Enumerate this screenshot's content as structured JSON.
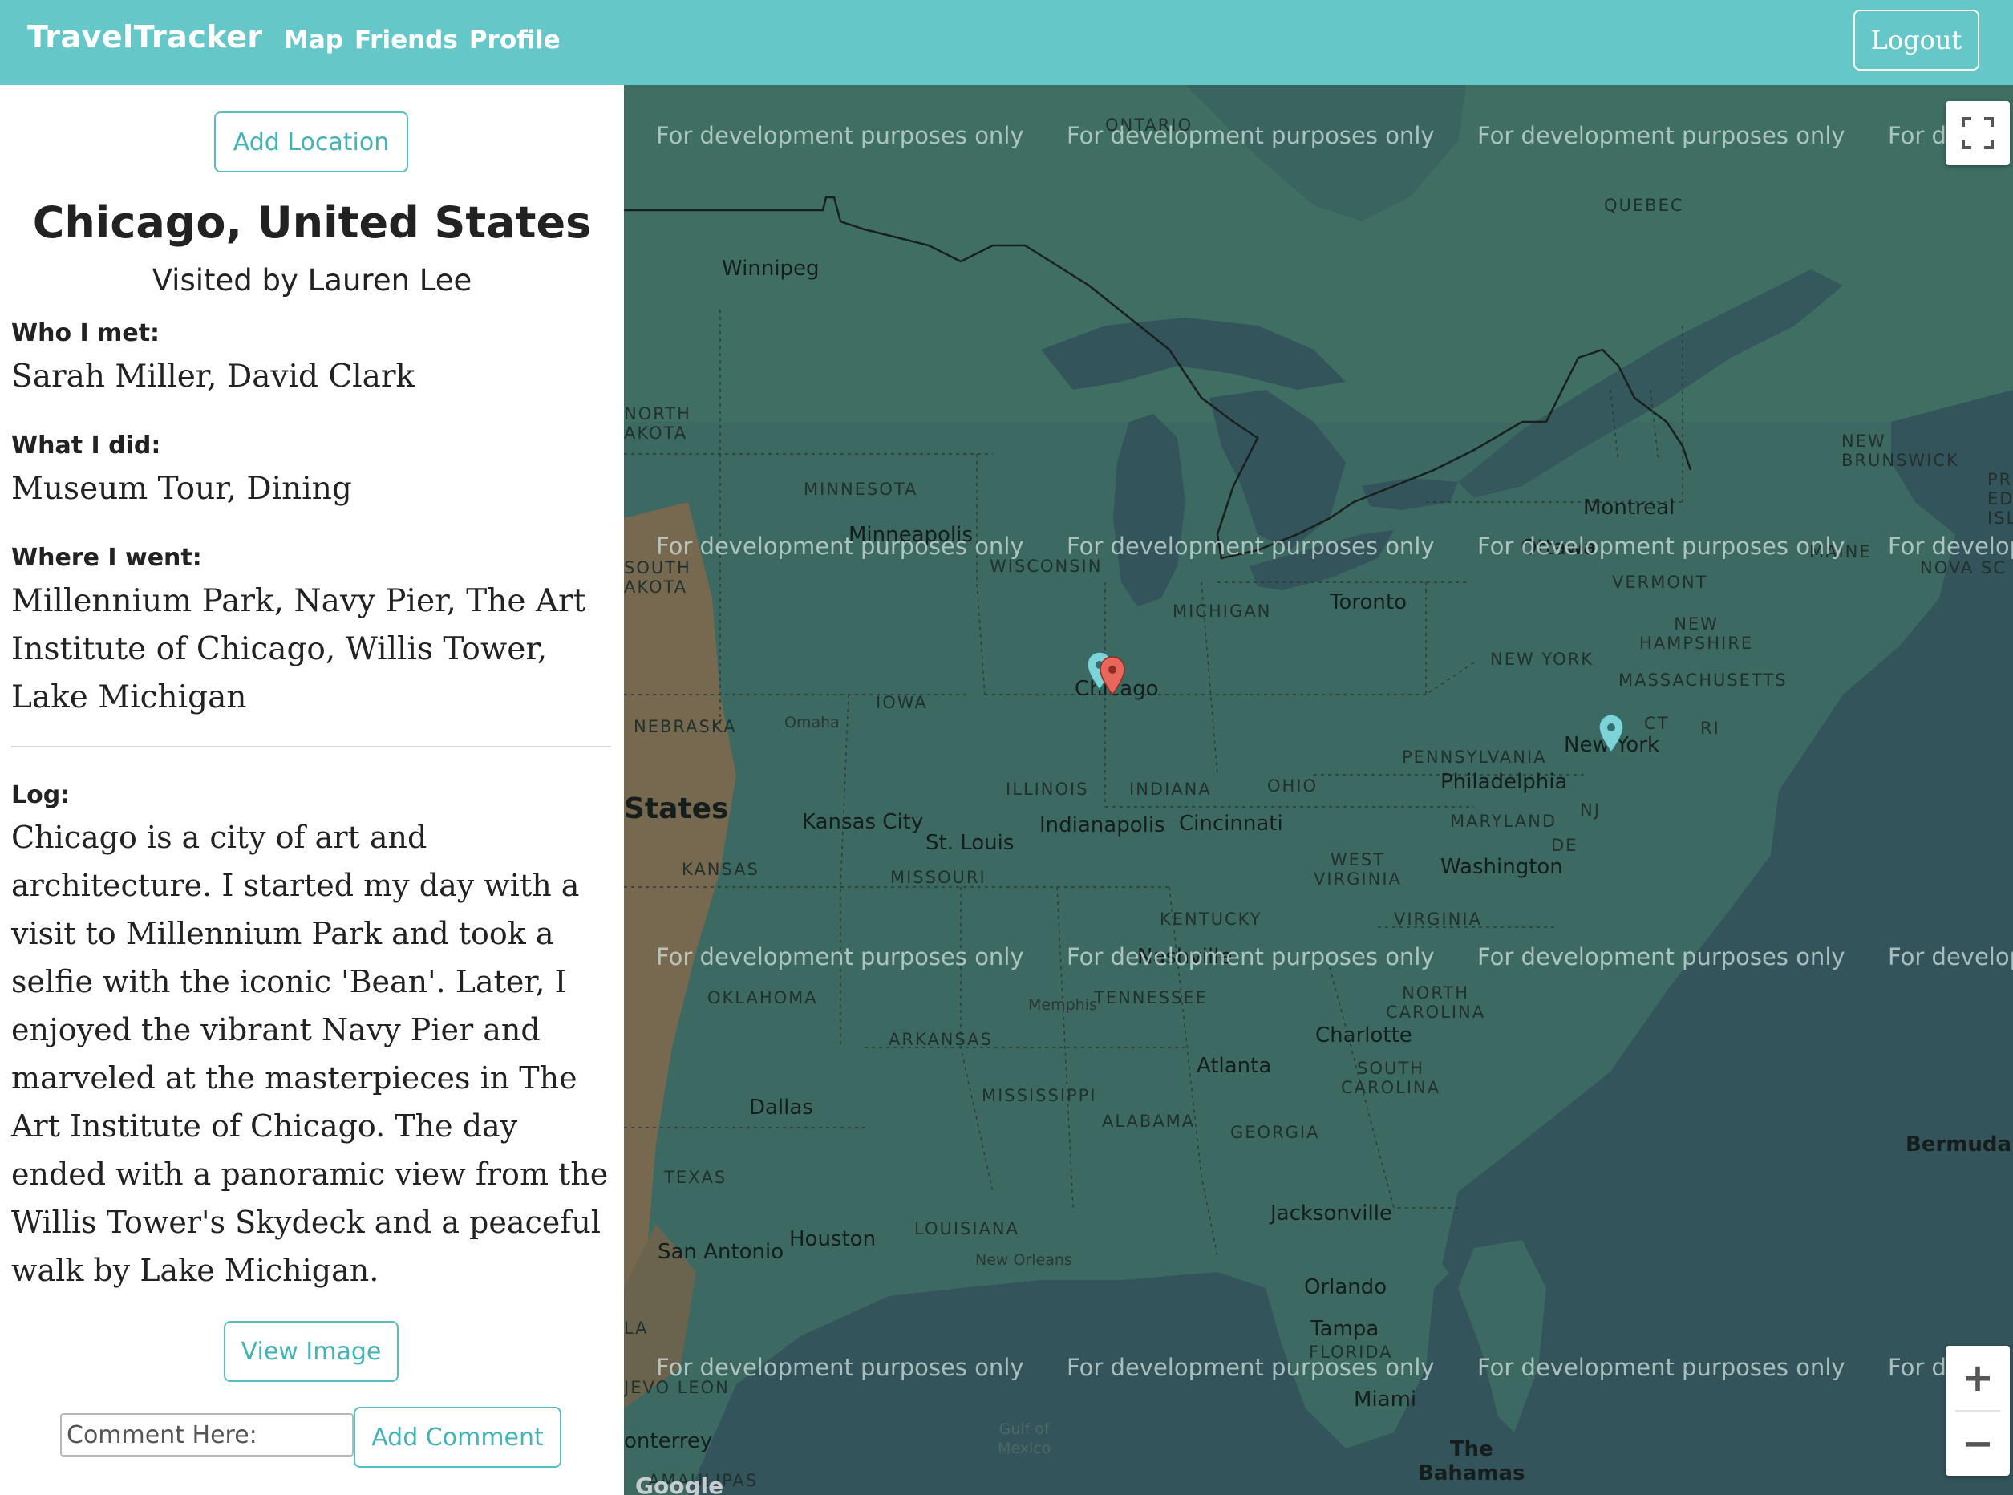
{
  "nav": {
    "brand": "TravelTracker",
    "links": [
      "Map",
      "Friends",
      "Profile"
    ],
    "logout": "Logout"
  },
  "sidebar": {
    "add_location": "Add Location",
    "title": "Chicago, United States",
    "visited_by": "Visited by Lauren Lee",
    "who_label": "Who I met:",
    "who_value": "Sarah Miller, David Clark",
    "what_label": "What I did:",
    "what_value": "Museum Tour, Dining",
    "where_label": "Where I went:",
    "where_value": "Millennium Park, Navy Pier, The Art Institute of Chicago, Willis Tower, Lake Michigan",
    "log_label": "Log:",
    "log_value": "Chicago is a city of art and architecture. I started my day with a visit to Millennium Park and took a selfie with the iconic 'Bean'. Later, I enjoyed the vibrant Navy Pier and marveled at the masterpieces in The Art Institute of Chicago. The day ended with a panoramic view from the Willis Tower's Skydeck and a peaceful walk by Lake Michigan.",
    "view_image": "View Image",
    "comment_placeholder": "Comment Here:",
    "add_comment": "Add Comment"
  },
  "map": {
    "watermark": "For development purposes only",
    "watermark_clipped": "For d",
    "watermark_clipped2": "For develop",
    "zoom_in": "+",
    "zoom_out": "−",
    "google": "Google",
    "labels": {
      "ontario": "ONTARIO",
      "quebec": "QUEBEC",
      "winnipeg": "Winnipeg",
      "north_dakota": "NORTH\nAKOTA",
      "minnesota": "MINNESOTA",
      "minneapolis": "Minneapolis",
      "wisconsin": "WISCONSIN",
      "south_dakota": "SOUTH\nAKOTA",
      "michigan": "MICHIGAN",
      "toronto": "Toronto",
      "montreal": "Montreal",
      "ottawa": "Ottawa",
      "new_brunswick": "NEW\nBRUNSWICK",
      "pei": "PR\nED\nISL",
      "maine": "MAINE",
      "nova_scotia": "NOVA SC",
      "vermont": "VERMONT",
      "new_hampshire": "NEW\nHAMPSHIRE",
      "massachusetts": "MASSACHUSETTS",
      "new_york_state": "NEW YORK",
      "ct": "CT",
      "ri": "RI",
      "new_york_city": "New York",
      "chicago": "Chicago",
      "iowa": "IOWA",
      "nebraska": "NEBRASKA",
      "omaha": "Omaha",
      "pennsylvania": "PENNSYLVANIA",
      "philadelphia": "Philadelphia",
      "nj": "NJ",
      "maryland": "MARYLAND",
      "de": "DE",
      "washington": "Washington",
      "states": "States",
      "kansas_city": "Kansas City",
      "st_louis": "St. Louis",
      "illinois": "ILLINOIS",
      "indiana": "INDIANA",
      "ohio": "OHIO",
      "indianapolis": "Indianapolis",
      "cincinnati": "Cincinnati",
      "kansas": "KANSAS",
      "missouri": "MISSOURI",
      "west_virginia": "WEST\nVIRGINIA",
      "kentucky": "KENTUCKY",
      "virginia": "VIRGINIA",
      "nashville": "Nashville",
      "tennessee": "TENNESSEE",
      "oklahoma": "OKLAHOMA",
      "memphis": "Memphis",
      "north_carolina": "NORTH\nCAROLINA",
      "charlotte": "Charlotte",
      "arkansas": "ARKANSAS",
      "atlanta": "Atlanta",
      "south_carolina": "SOUTH\nCAROLINA",
      "mississippi": "MISSISSIPPI",
      "alabama": "ALABAMA",
      "georgia": "GEORGIA",
      "dallas": "Dallas",
      "bermuda": "Bermuda",
      "texas": "TEXAS",
      "jacksonville": "Jacksonville",
      "louisiana": "LOUISIANA",
      "houston": "Houston",
      "san_antonio": "San Antonio",
      "new_orleans": "New Orleans",
      "orlando": "Orlando",
      "tampa": "Tampa",
      "florida": "FLORIDA",
      "la": "LA",
      "nuevo_leon": "JEVO LEON",
      "miami": "Miami",
      "gulf": "Gulf of\nMexico",
      "monterrey": "onterrey",
      "bahamas": "The\nBahamas",
      "tamaulipas": "AMAULIPAS"
    }
  },
  "colors": {
    "navbar": "#66c7c9",
    "accent": "#44b3b6",
    "map_land": "#3c6a63",
    "map_water": "#34555a",
    "pin_red": "#e8675c",
    "pin_teal": "#7dd3d6"
  },
  "icons": {
    "fullscreen": "fullscreen-icon",
    "pin_selected": "map-pin-red-icon",
    "pin_other": "map-pin-teal-icon"
  }
}
